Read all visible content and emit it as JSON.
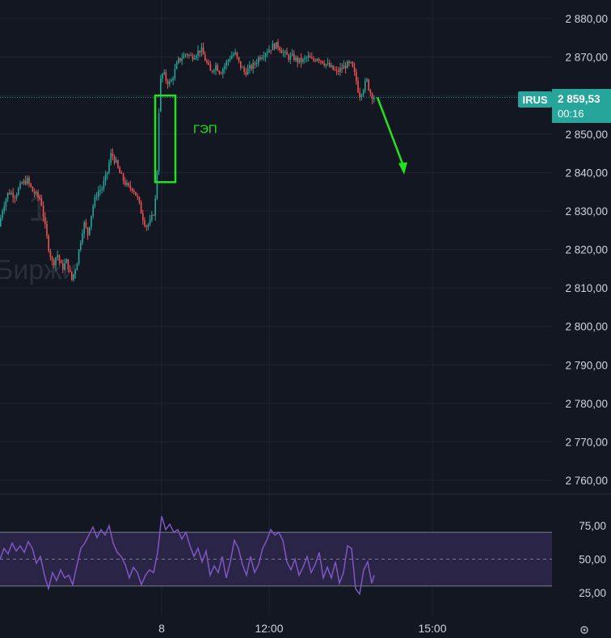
{
  "chart_data": {
    "type": "candlestick",
    "symbol": "IRUS",
    "current_price": 2859.53,
    "current_price_label": "2 859,53",
    "countdown": "00:16",
    "price_axis": {
      "ylim": [
        2752,
        2884
      ],
      "ticks": [
        2880,
        2870,
        2860,
        2850,
        2840,
        2830,
        2820,
        2810,
        2800,
        2790,
        2780,
        2770,
        2760
      ],
      "tick_labels": [
        "2 880,00",
        "2 870,00",
        "2 850,00",
        "2 840,00",
        "2 830,00",
        "2 820,00",
        "2 810,00",
        "2 800,00",
        "2 790,00",
        "2 780,00",
        "2 770,00",
        "2 760,00"
      ]
    },
    "time_axis": {
      "labels": [
        "8",
        "12:00",
        "15:00"
      ]
    },
    "price_path": [
      [
        0,
        2826
      ],
      [
        5,
        2831
      ],
      [
        12,
        2835
      ],
      [
        20,
        2834
      ],
      [
        28,
        2837
      ],
      [
        35,
        2838
      ],
      [
        42,
        2835
      ],
      [
        52,
        2833
      ],
      [
        57,
        2826
      ],
      [
        62,
        2820
      ],
      [
        67,
        2816
      ],
      [
        72,
        2819
      ],
      [
        78,
        2815
      ],
      [
        84,
        2817
      ],
      [
        90,
        2812
      ],
      [
        96,
        2816
      ],
      [
        100,
        2821
      ],
      [
        105,
        2827
      ],
      [
        110,
        2824
      ],
      [
        116,
        2831
      ],
      [
        122,
        2835
      ],
      [
        128,
        2836
      ],
      [
        134,
        2840
      ],
      [
        139,
        2845
      ],
      [
        144,
        2843
      ],
      [
        149,
        2840
      ],
      [
        154,
        2838
      ],
      [
        160,
        2836
      ],
      [
        166,
        2836
      ],
      [
        172,
        2833
      ],
      [
        177,
        2829
      ],
      [
        182,
        2826
      ],
      [
        187,
        2827
      ],
      [
        191,
        2829
      ],
      [
        195,
        2835
      ],
      [
        199,
        2863
      ],
      [
        203,
        2866
      ],
      [
        207,
        2864
      ],
      [
        212,
        2863
      ],
      [
        217,
        2866
      ],
      [
        222,
        2869
      ],
      [
        227,
        2870
      ],
      [
        232,
        2871
      ],
      [
        238,
        2870
      ],
      [
        244,
        2871
      ],
      [
        250,
        2872
      ],
      [
        256,
        2869
      ],
      [
        262,
        2866
      ],
      [
        268,
        2868
      ],
      [
        274,
        2866
      ],
      [
        280,
        2868
      ],
      [
        286,
        2870
      ],
      [
        292,
        2871
      ],
      [
        298,
        2868
      ],
      [
        304,
        2866
      ],
      [
        310,
        2867
      ],
      [
        316,
        2868
      ],
      [
        322,
        2870
      ],
      [
        328,
        2871
      ],
      [
        334,
        2872
      ],
      [
        340,
        2873
      ],
      [
        346,
        2873
      ],
      [
        352,
        2871
      ],
      [
        358,
        2870
      ],
      [
        364,
        2870
      ],
      [
        370,
        2869
      ],
      [
        376,
        2869
      ],
      [
        382,
        2870
      ],
      [
        388,
        2869
      ],
      [
        394,
        2870
      ],
      [
        400,
        2869
      ],
      [
        406,
        2868
      ],
      [
        412,
        2867
      ],
      [
        418,
        2866
      ],
      [
        424,
        2867
      ],
      [
        430,
        2868
      ],
      [
        436,
        2868
      ],
      [
        441,
        2865
      ],
      [
        446,
        2860
      ],
      [
        451,
        2862
      ],
      [
        455,
        2864
      ],
      [
        459,
        2861
      ],
      [
        463,
        2859.53
      ]
    ],
    "annotations": [
      {
        "type": "rectangle",
        "label": "ГЭП",
        "color": "#22e222",
        "x_range": [
          192,
          217
        ],
        "y_range": [
          2837.5,
          2860
        ]
      },
      {
        "type": "arrow",
        "color": "#22e222",
        "from": [
          467,
          2859.53
        ],
        "to": [
          500,
          2839.5
        ]
      }
    ],
    "rsi": {
      "ylim": [
        15,
        85
      ],
      "levels": [
        70,
        30
      ],
      "midline": 50,
      "tick_labels": [
        "75,00",
        "50,00",
        "25,00"
      ],
      "tick_values": [
        75,
        50,
        25
      ],
      "color": "#7e57c2",
      "values": [
        [
          0,
          50
        ],
        [
          5,
          58
        ],
        [
          10,
          54
        ],
        [
          15,
          62
        ],
        [
          20,
          56
        ],
        [
          25,
          60
        ],
        [
          30,
          55
        ],
        [
          35,
          63
        ],
        [
          40,
          58
        ],
        [
          45,
          47
        ],
        [
          50,
          52
        ],
        [
          55,
          38
        ],
        [
          60,
          28
        ],
        [
          65,
          40
        ],
        [
          70,
          34
        ],
        [
          75,
          42
        ],
        [
          80,
          36
        ],
        [
          85,
          38
        ],
        [
          90,
          31
        ],
        [
          95,
          45
        ],
        [
          100,
          58
        ],
        [
          105,
          62
        ],
        [
          110,
          68
        ],
        [
          115,
          74
        ],
        [
          120,
          66
        ],
        [
          125,
          72
        ],
        [
          130,
          68
        ],
        [
          135,
          75
        ],
        [
          140,
          62
        ],
        [
          145,
          55
        ],
        [
          150,
          52
        ],
        [
          155,
          46
        ],
        [
          160,
          36
        ],
        [
          165,
          44
        ],
        [
          170,
          40
        ],
        [
          175,
          31
        ],
        [
          180,
          38
        ],
        [
          185,
          42
        ],
        [
          190,
          40
        ],
        [
          195,
          55
        ],
        [
          200,
          82
        ],
        [
          205,
          72
        ],
        [
          210,
          76
        ],
        [
          215,
          70
        ],
        [
          220,
          72
        ],
        [
          225,
          65
        ],
        [
          230,
          70
        ],
        [
          235,
          60
        ],
        [
          240,
          52
        ],
        [
          245,
          58
        ],
        [
          250,
          48
        ],
        [
          255,
          56
        ],
        [
          260,
          38
        ],
        [
          265,
          45
        ],
        [
          270,
          40
        ],
        [
          275,
          52
        ],
        [
          280,
          36
        ],
        [
          285,
          48
        ],
        [
          290,
          64
        ],
        [
          295,
          58
        ],
        [
          300,
          46
        ],
        [
          305,
          38
        ],
        [
          310,
          52
        ],
        [
          315,
          40
        ],
        [
          320,
          46
        ],
        [
          325,
          58
        ],
        [
          330,
          64
        ],
        [
          335,
          72
        ],
        [
          340,
          68
        ],
        [
          345,
          70
        ],
        [
          350,
          64
        ],
        [
          355,
          48
        ],
        [
          360,
          42
        ],
        [
          365,
          50
        ],
        [
          370,
          38
        ],
        [
          375,
          44
        ],
        [
          380,
          52
        ],
        [
          385,
          40
        ],
        [
          390,
          46
        ],
        [
          395,
          55
        ],
        [
          400,
          36
        ],
        [
          405,
          44
        ],
        [
          410,
          36
        ],
        [
          415,
          48
        ],
        [
          420,
          32
        ],
        [
          425,
          40
        ],
        [
          430,
          60
        ],
        [
          435,
          58
        ],
        [
          440,
          28
        ],
        [
          445,
          24
        ],
        [
          450,
          42
        ],
        [
          455,
          48
        ],
        [
          460,
          32
        ],
        [
          463,
          38
        ]
      ]
    }
  },
  "watermark": {
    "text": "Биржи",
    "glyph": "1"
  },
  "colors": {
    "background": "#131722",
    "grid": "#1f2330",
    "up": "#26a69a",
    "down": "#ef5350",
    "price_line": "#26a69a",
    "rsi_band": "#2a2546",
    "rsi_line": "#7e57c2",
    "annotation": "#22e222"
  },
  "icons": {
    "settings": "settings-gear-icon"
  }
}
